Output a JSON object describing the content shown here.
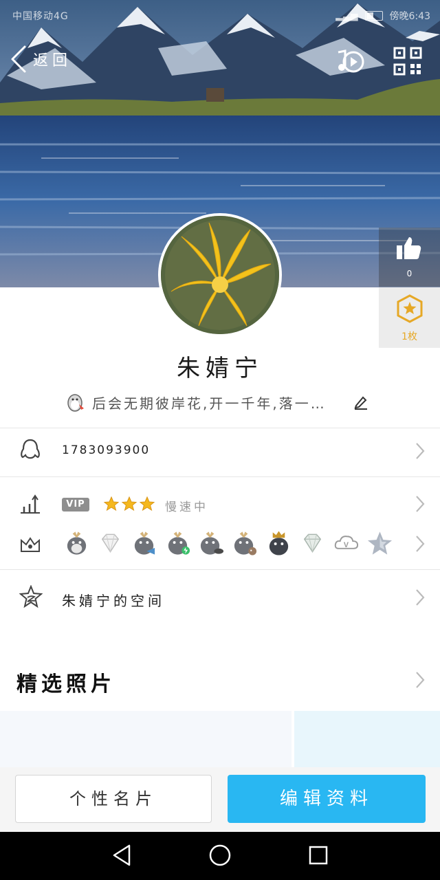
{
  "status_bar": {
    "carrier": "中国移动4G",
    "time": "傍晚6:43"
  },
  "header": {
    "back_label": "返回"
  },
  "like": {
    "count": "0"
  },
  "coins": {
    "count": "1枚"
  },
  "profile": {
    "nickname": "朱婧宁",
    "signature": "后会无期彼岸花,开一千年,落一…"
  },
  "qq": {
    "number": "1783093900"
  },
  "level": {
    "vip_label": "VIP",
    "stars": 3,
    "speed_text": "慢速中"
  },
  "space": {
    "label": "朱婧宁的空间"
  },
  "photos": {
    "title": "精选照片"
  },
  "actions": {
    "card_label": "个性名片",
    "edit_label": "编辑资料"
  },
  "colors": {
    "accent": "#29b7f2",
    "star": "#f5b81e",
    "coin": "#e6a826"
  },
  "icons": [
    "back-icon",
    "music-icon",
    "qr-code-icon",
    "thumbs-up-icon",
    "coin-icon",
    "edit-icon",
    "penguin-icon",
    "level-icon",
    "crown-icon",
    "space-star-icon",
    "chevron-right-icon"
  ]
}
